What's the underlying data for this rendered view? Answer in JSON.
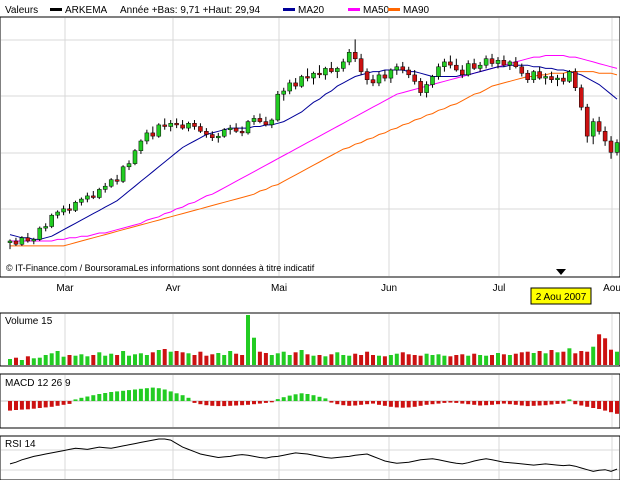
{
  "legend": {
    "items": [
      {
        "label": "Valeurs",
        "color": "#000000",
        "marker": false
      },
      {
        "label": "ARKEMA",
        "color": "#000000",
        "marker": true
      },
      {
        "label": "Année +Bas: 9,71 +Haut: 29,94",
        "color": "#000000",
        "marker": false
      },
      {
        "label": "MA20",
        "color": "#000099",
        "marker": true
      },
      {
        "label": "MA50",
        "color": "#ff00ff",
        "marker": true
      },
      {
        "label": "MA90",
        "color": "#ff6600",
        "marker": true
      }
    ]
  },
  "source_note": "© IT-Finance.com / BoursoramaLes informations sont données à titre indicatif",
  "cursor_date": "2 Aou 2007",
  "colors": {
    "up": "#22cc22",
    "down": "#cc1111",
    "grid": "#d8d8d8",
    "ma20": "#000099",
    "ma50": "#ff00ff",
    "ma90": "#ff6600",
    "cursor_box": "#ffff00"
  },
  "chart_data": [
    {
      "type": "candlestick",
      "name": "ARKEMA",
      "months": [
        "Mar",
        "Avr",
        "Mai",
        "Jun",
        "Jul",
        "Aou"
      ],
      "price_bars": [
        [
          12.2,
          12.4,
          11.8,
          12.3
        ],
        [
          12.3,
          12.5,
          12.0,
          12.1
        ],
        [
          12.1,
          12.6,
          12.0,
          12.5
        ],
        [
          12.5,
          12.8,
          12.2,
          12.3
        ],
        [
          12.3,
          12.5,
          12.1,
          12.4
        ],
        [
          12.4,
          13.2,
          12.3,
          13.1
        ],
        [
          13.1,
          13.4,
          12.9,
          13.2
        ],
        [
          13.2,
          14.0,
          13.1,
          13.9
        ],
        [
          13.9,
          14.2,
          13.7,
          14.1
        ],
        [
          14.1,
          14.5,
          13.9,
          14.3
        ],
        [
          14.3,
          14.6,
          14.0,
          14.2
        ],
        [
          14.2,
          14.8,
          14.1,
          14.7
        ],
        [
          14.7,
          15.0,
          14.5,
          14.9
        ],
        [
          14.9,
          15.3,
          14.7,
          15.1
        ],
        [
          15.1,
          15.4,
          14.9,
          15.0
        ],
        [
          15.0,
          15.6,
          14.9,
          15.5
        ],
        [
          15.5,
          15.9,
          15.3,
          15.7
        ],
        [
          15.7,
          16.2,
          15.6,
          16.1
        ],
        [
          16.1,
          16.4,
          15.8,
          16.0
        ],
        [
          16.0,
          17.0,
          15.9,
          16.9
        ],
        [
          16.9,
          17.3,
          16.7,
          17.1
        ],
        [
          17.1,
          18.0,
          17.0,
          17.9
        ],
        [
          17.9,
          18.6,
          17.7,
          18.5
        ],
        [
          18.5,
          19.2,
          18.3,
          19.0
        ],
        [
          19.0,
          19.4,
          18.6,
          18.8
        ],
        [
          18.8,
          19.6,
          18.7,
          19.5
        ],
        [
          19.5,
          19.9,
          19.2,
          19.4
        ],
        [
          19.4,
          19.8,
          19.1,
          19.6
        ],
        [
          19.6,
          19.9,
          19.3,
          19.5
        ],
        [
          19.5,
          19.8,
          19.2,
          19.3
        ],
        [
          19.3,
          19.7,
          19.1,
          19.6
        ],
        [
          19.6,
          19.8,
          19.2,
          19.4
        ],
        [
          19.4,
          19.6,
          19.0,
          19.1
        ],
        [
          19.1,
          19.3,
          18.7,
          18.9
        ],
        [
          18.9,
          19.1,
          18.5,
          18.7
        ],
        [
          18.7,
          19.0,
          18.4,
          18.8
        ],
        [
          18.8,
          19.3,
          18.7,
          19.2
        ],
        [
          19.2,
          19.5,
          18.9,
          19.3
        ],
        [
          19.3,
          19.6,
          19.0,
          19.1
        ],
        [
          19.1,
          19.4,
          18.8,
          19.0
        ],
        [
          19.0,
          19.8,
          18.9,
          19.7
        ],
        [
          19.7,
          20.1,
          19.5,
          19.9
        ],
        [
          19.9,
          20.2,
          19.6,
          19.7
        ],
        [
          19.7,
          20.0,
          19.4,
          19.5
        ],
        [
          19.5,
          19.9,
          19.3,
          19.8
        ],
        [
          19.8,
          21.6,
          19.7,
          21.4
        ],
        [
          21.4,
          21.8,
          21.0,
          21.6
        ],
        [
          21.6,
          22.3,
          21.4,
          22.1
        ],
        [
          22.1,
          22.4,
          21.7,
          21.9
        ],
        [
          21.9,
          22.6,
          21.8,
          22.5
        ],
        [
          22.5,
          23.0,
          22.2,
          22.4
        ],
        [
          22.4,
          22.8,
          22.0,
          22.7
        ],
        [
          22.7,
          23.2,
          22.4,
          22.6
        ],
        [
          22.6,
          23.1,
          22.3,
          23.0
        ],
        [
          23.0,
          23.4,
          22.7,
          22.8
        ],
        [
          22.8,
          23.1,
          22.4,
          23.0
        ],
        [
          23.0,
          23.6,
          22.8,
          23.4
        ],
        [
          23.4,
          24.2,
          23.2,
          24.0
        ],
        [
          24.0,
          24.8,
          23.4,
          23.6
        ],
        [
          23.6,
          23.9,
          22.6,
          22.8
        ],
        [
          22.8,
          23.0,
          22.0,
          22.3
        ],
        [
          22.3,
          22.6,
          21.9,
          22.1
        ],
        [
          22.1,
          22.8,
          21.9,
          22.6
        ],
        [
          22.6,
          22.9,
          22.2,
          22.4
        ],
        [
          22.4,
          23.0,
          22.1,
          22.9
        ],
        [
          22.9,
          23.3,
          22.6,
          23.1
        ],
        [
          23.1,
          23.4,
          22.7,
          22.9
        ],
        [
          22.9,
          23.1,
          22.4,
          22.6
        ],
        [
          22.6,
          22.9,
          22.0,
          22.2
        ],
        [
          22.2,
          22.4,
          21.3,
          21.5
        ],
        [
          21.5,
          22.2,
          21.2,
          22.0
        ],
        [
          22.0,
          22.6,
          21.8,
          22.5
        ],
        [
          22.5,
          23.3,
          22.3,
          23.1
        ],
        [
          23.1,
          23.6,
          22.8,
          23.4
        ],
        [
          23.4,
          23.8,
          23.0,
          23.2
        ],
        [
          23.2,
          23.6,
          22.8,
          22.9
        ],
        [
          22.9,
          23.2,
          22.4,
          22.6
        ],
        [
          22.6,
          23.5,
          22.5,
          23.3
        ],
        [
          23.3,
          23.6,
          22.9,
          23.0
        ],
        [
          23.0,
          23.4,
          22.8,
          23.2
        ],
        [
          23.2,
          23.8,
          23.0,
          23.6
        ],
        [
          23.6,
          23.9,
          23.1,
          23.3
        ],
        [
          23.3,
          23.7,
          23.0,
          23.5
        ],
        [
          23.5,
          23.8,
          23.1,
          23.2
        ],
        [
          23.2,
          23.5,
          22.9,
          23.4
        ],
        [
          23.4,
          23.7,
          23.0,
          23.1
        ],
        [
          23.1,
          23.3,
          22.5,
          22.7
        ],
        [
          22.7,
          22.9,
          22.1,
          22.3
        ],
        [
          22.3,
          22.9,
          22.1,
          22.8
        ],
        [
          22.8,
          23.1,
          22.3,
          22.4
        ],
        [
          22.4,
          22.7,
          22.0,
          22.5
        ],
        [
          22.5,
          22.8,
          22.1,
          22.3
        ],
        [
          22.3,
          22.6,
          21.9,
          22.4
        ],
        [
          22.4,
          22.7,
          22.0,
          22.2
        ],
        [
          22.2,
          22.9,
          22.1,
          22.8
        ],
        [
          22.8,
          23.0,
          21.6,
          21.8
        ],
        [
          21.8,
          22.0,
          20.4,
          20.6
        ],
        [
          20.6,
          20.8,
          18.4,
          18.8
        ],
        [
          18.8,
          19.9,
          18.3,
          19.7
        ],
        [
          19.7,
          20.0,
          18.9,
          19.1
        ],
        [
          19.1,
          19.4,
          18.2,
          18.5
        ],
        [
          18.5,
          18.8,
          17.4,
          17.8
        ],
        [
          17.8,
          18.6,
          17.6,
          18.4
        ]
      ],
      "ma20": [
        12.7,
        12.6,
        12.5,
        12.5,
        12.4,
        12.4,
        12.5,
        12.6,
        12.8,
        13.0,
        13.2,
        13.4,
        13.6,
        13.8,
        14.0,
        14.2,
        14.4,
        14.6,
        14.8,
        15.1,
        15.4,
        15.7,
        16.0,
        16.3,
        16.6,
        16.9,
        17.2,
        17.5,
        17.8,
        18.1,
        18.3,
        18.5,
        18.7,
        18.9,
        19.0,
        19.1,
        19.2,
        19.3,
        19.3,
        19.3,
        19.3,
        19.4,
        19.4,
        19.5,
        19.5,
        19.6,
        19.7,
        19.9,
        20.1,
        20.3,
        20.6,
        20.9,
        21.1,
        21.4,
        21.6,
        21.9,
        22.1,
        22.3,
        22.5,
        22.6,
        22.7,
        22.8,
        22.8,
        22.9,
        22.9,
        22.9,
        22.9,
        22.8,
        22.8,
        22.7,
        22.6,
        22.5,
        22.5,
        22.5,
        22.5,
        22.5,
        22.6,
        22.6,
        22.7,
        22.8,
        22.9,
        23.0,
        23.1,
        23.1,
        23.2,
        23.2,
        23.2,
        23.2,
        23.1,
        23.1,
        23.0,
        23.0,
        22.9,
        22.9,
        22.8,
        22.7,
        22.6,
        22.4,
        22.2,
        22.0,
        21.7,
        21.4,
        21.1
      ],
      "ma50": [
        12.3,
        12.3,
        12.3,
        12.3,
        12.3,
        12.3,
        12.3,
        12.3,
        12.4,
        12.4,
        12.5,
        12.5,
        12.6,
        12.6,
        12.7,
        12.8,
        12.8,
        12.9,
        13.0,
        13.1,
        13.2,
        13.3,
        13.4,
        13.6,
        13.7,
        13.8,
        14.0,
        14.1,
        14.3,
        14.4,
        14.6,
        14.7,
        14.9,
        15.1,
        15.2,
        15.4,
        15.6,
        15.8,
        16.0,
        16.2,
        16.4,
        16.6,
        16.8,
        17.0,
        17.2,
        17.4,
        17.6,
        17.8,
        18.0,
        18.2,
        18.4,
        18.6,
        18.8,
        19.0,
        19.2,
        19.4,
        19.6,
        19.8,
        20.0,
        20.2,
        20.4,
        20.6,
        20.8,
        21.0,
        21.2,
        21.4,
        21.5,
        21.6,
        21.7,
        21.8,
        21.9,
        22.0,
        22.1,
        22.2,
        22.3,
        22.4,
        22.5,
        22.6,
        22.7,
        22.8,
        22.9,
        23.0,
        23.1,
        23.2,
        23.3,
        23.4,
        23.5,
        23.6,
        23.7,
        23.7,
        23.8,
        23.8,
        23.8,
        23.8,
        23.7,
        23.7,
        23.6,
        23.5,
        23.4,
        23.3,
        23.2,
        23.1,
        23.0
      ],
      "ma90": [
        12.0,
        12.0,
        12.0,
        12.0,
        12.0,
        12.0,
        12.0,
        12.0,
        12.0,
        12.0,
        12.1,
        12.2,
        12.3,
        12.4,
        12.5,
        12.6,
        12.7,
        12.8,
        12.9,
        13.0,
        13.1,
        13.2,
        13.3,
        13.4,
        13.5,
        13.6,
        13.7,
        13.8,
        13.9,
        14.0,
        14.1,
        14.2,
        14.3,
        14.4,
        14.5,
        14.6,
        14.7,
        14.8,
        14.9,
        15.0,
        15.1,
        15.2,
        15.4,
        15.5,
        15.7,
        15.8,
        16.0,
        16.2,
        16.4,
        16.6,
        16.8,
        17.0,
        17.2,
        17.4,
        17.6,
        17.8,
        18.0,
        18.1,
        18.3,
        18.4,
        18.6,
        18.7,
        18.9,
        19.0,
        19.2,
        19.3,
        19.5,
        19.6,
        19.8,
        19.9,
        20.1,
        20.2,
        20.4,
        20.5,
        20.7,
        20.8,
        21.0,
        21.2,
        21.4,
        21.5,
        21.7,
        21.9,
        22.0,
        22.1,
        22.2,
        22.3,
        22.4,
        22.5,
        22.5,
        22.6,
        22.6,
        22.7,
        22.7,
        22.7,
        22.8,
        22.8,
        22.8,
        22.8,
        22.8,
        22.7,
        22.7,
        22.7,
        22.6
      ],
      "ylim": [
        11.0,
        26.0
      ]
    },
    {
      "type": "bar",
      "name": "Volume",
      "title": "Volume 15",
      "values": [
        18,
        22,
        15,
        26,
        20,
        22,
        30,
        35,
        42,
        25,
        30,
        28,
        32,
        26,
        30,
        38,
        28,
        34,
        30,
        42,
        28,
        32,
        35,
        30,
        38,
        45,
        48,
        40,
        42,
        38,
        35,
        30,
        40,
        28,
        32,
        36,
        30,
        42,
        34,
        30,
        150,
        82,
        40,
        36,
        30,
        35,
        40,
        30,
        38,
        45,
        32,
        28,
        30,
        26,
        32,
        38,
        30,
        28,
        34,
        30,
        40,
        30,
        28,
        26,
        30,
        34,
        38,
        32,
        30,
        28,
        34,
        30,
        32,
        28,
        26,
        30,
        32,
        28,
        34,
        30,
        28,
        30,
        36,
        32,
        30,
        34,
        38,
        40,
        36,
        42,
        35,
        45,
        38,
        40,
        50,
        35,
        42,
        40,
        55,
        92,
        80,
        46,
        40
      ]
    },
    {
      "type": "bar",
      "name": "MACD",
      "title": "MACD 12 26 9",
      "values": [
        -0.3,
        -0.28,
        -0.27,
        -0.26,
        -0.24,
        -0.22,
        -0.2,
        -0.18,
        -0.15,
        -0.12,
        -0.09,
        0.05,
        0.1,
        0.14,
        0.18,
        0.22,
        0.25,
        0.28,
        0.3,
        0.32,
        0.34,
        0.36,
        0.38,
        0.4,
        0.42,
        0.4,
        0.36,
        0.3,
        0.24,
        0.18,
        0.1,
        -0.06,
        -0.1,
        -0.13,
        -0.15,
        -0.16,
        -0.16,
        -0.15,
        -0.14,
        -0.13,
        -0.12,
        -0.1,
        -0.08,
        -0.06,
        -0.04,
        0.06,
        0.12,
        0.17,
        0.21,
        0.24,
        0.22,
        0.18,
        0.13,
        0.08,
        -0.05,
        -0.1,
        -0.13,
        -0.15,
        -0.14,
        -0.12,
        -0.1,
        -0.08,
        -0.12,
        -0.15,
        -0.18,
        -0.2,
        -0.21,
        -0.2,
        -0.18,
        -0.15,
        -0.12,
        -0.1,
        -0.08,
        -0.06,
        -0.05,
        -0.06,
        -0.08,
        -0.1,
        -0.12,
        -0.14,
        -0.13,
        -0.12,
        -0.1,
        -0.08,
        -0.1,
        -0.12,
        -0.14,
        -0.16,
        -0.15,
        -0.14,
        -0.13,
        -0.11,
        -0.09,
        -0.08,
        0.05,
        -0.1,
        -0.14,
        -0.18,
        -0.22,
        -0.25,
        -0.3,
        -0.35,
        -0.4
      ]
    },
    {
      "type": "line",
      "name": "RSI",
      "title": "RSI 14",
      "values": [
        45,
        48,
        52,
        55,
        58,
        60,
        62,
        64,
        66,
        68,
        70,
        72,
        71,
        70,
        72,
        74,
        73,
        72,
        74,
        76,
        78,
        80,
        82,
        84,
        86,
        88,
        88,
        86,
        80,
        74,
        70,
        66,
        62,
        60,
        58,
        56,
        57,
        58,
        60,
        61,
        60,
        58,
        56,
        55,
        57,
        58,
        60,
        62,
        64,
        63,
        62,
        60,
        58,
        56,
        55,
        56,
        57,
        58,
        60,
        61,
        62,
        58,
        54,
        50,
        48,
        46,
        47,
        48,
        50,
        52,
        53,
        54,
        52,
        50,
        48,
        46,
        45,
        47,
        50,
        52,
        54,
        52,
        50,
        48,
        47,
        46,
        45,
        44,
        43,
        44,
        45,
        44,
        43,
        42,
        43,
        41,
        38,
        35,
        32,
        34,
        35,
        32,
        36
      ]
    }
  ]
}
